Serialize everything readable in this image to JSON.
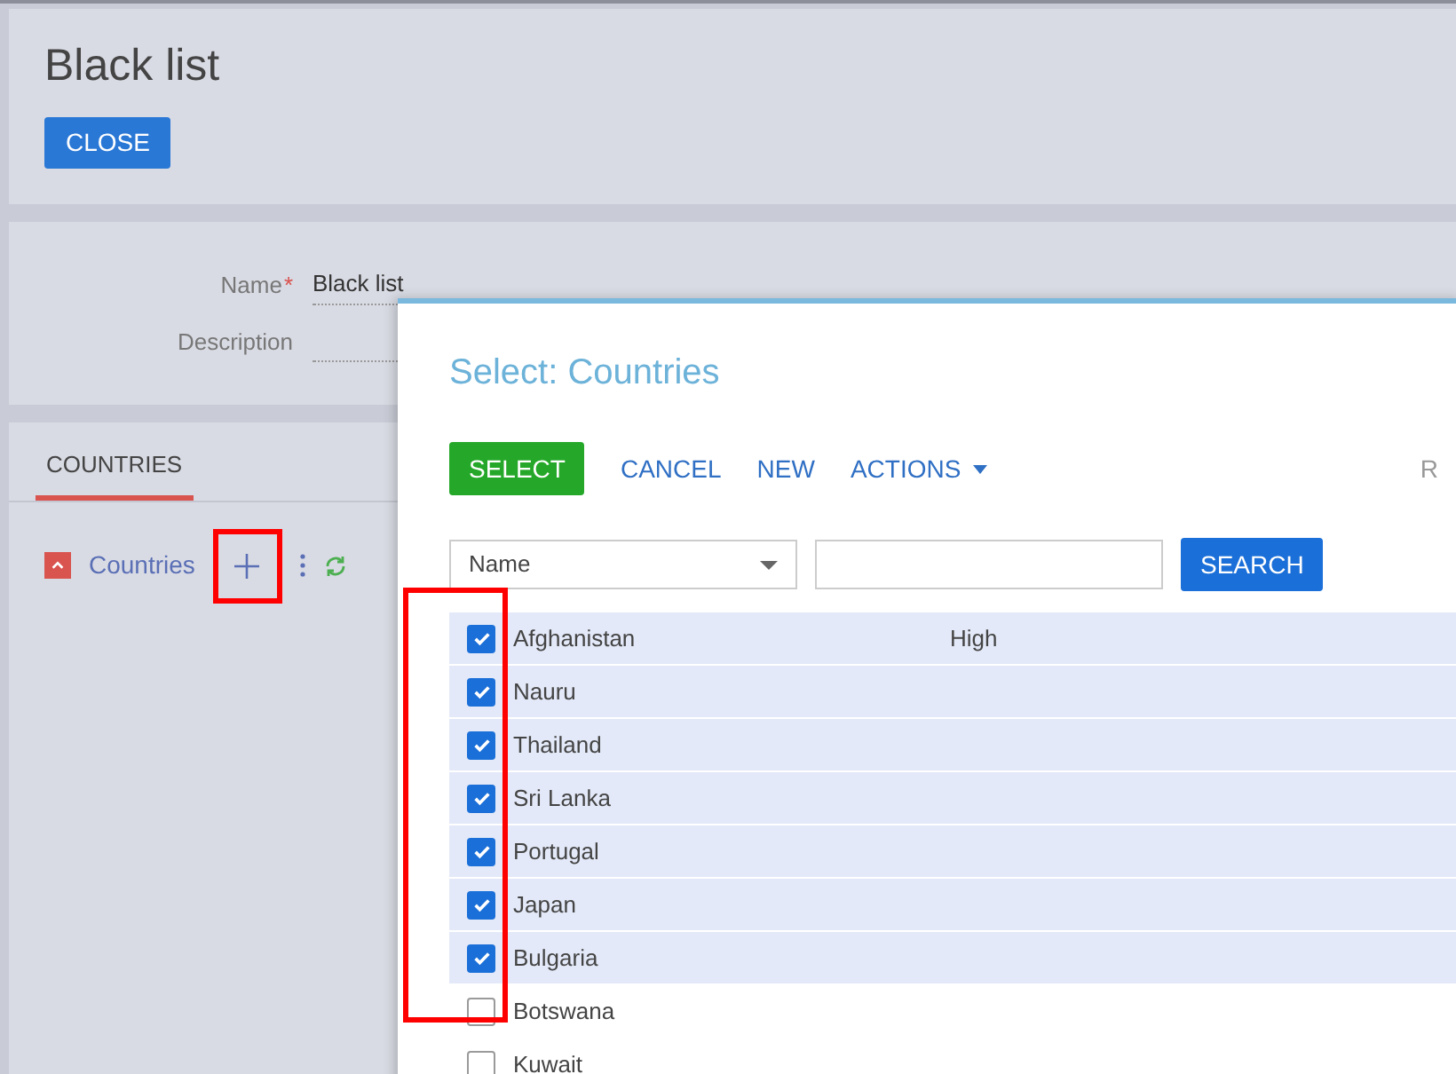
{
  "page": {
    "title": "Black list",
    "close_button": "CLOSE"
  },
  "form": {
    "fields": [
      {
        "label": "Name",
        "required_mark": "*",
        "value": "Black list"
      },
      {
        "label": "Description"
      }
    ]
  },
  "detail": {
    "tabs": [
      {
        "label": "COUNTRIES",
        "selected": true
      }
    ],
    "section_title": "Countries",
    "expanded": true,
    "highlighted_add": true
  },
  "dialog": {
    "title": "Select: Countries",
    "actions": [
      {
        "label": "SELECT",
        "kind": "primary"
      },
      {
        "label": "CANCEL",
        "kind": "link"
      },
      {
        "label": "NEW",
        "kind": "link"
      },
      {
        "label": "ACTIONS",
        "kind": "menu"
      }
    ],
    "right_text": "R",
    "filter": {
      "column": "Name",
      "search_button": "SEARCH"
    },
    "rows": [
      {
        "name": "Afghanistan",
        "column_2": "High",
        "checked": true
      },
      {
        "name": "Nauru",
        "checked": true
      },
      {
        "name": "Thailand",
        "checked": true
      },
      {
        "name": "Sri Lanka",
        "checked": true
      },
      {
        "name": "Portugal",
        "checked": true
      },
      {
        "name": "Japan",
        "checked": true
      },
      {
        "name": "Bulgaria",
        "checked": true
      },
      {
        "name": "Botswana",
        "checked": false
      },
      {
        "name": "Kuwait",
        "checked": false
      }
    ]
  }
}
